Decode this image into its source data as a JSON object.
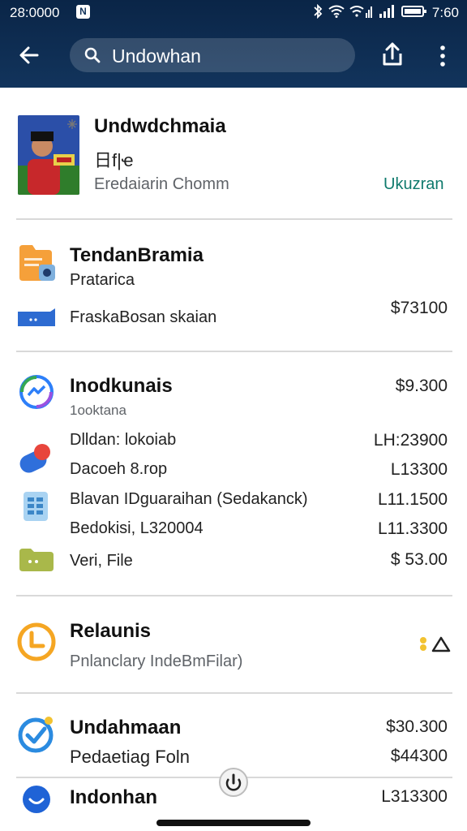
{
  "status_bar": {
    "time": "28:0000",
    "notification_glyph": "N",
    "clock": "7:60"
  },
  "search": {
    "query": "Undowhan"
  },
  "profile": {
    "name": "Undwdchmaia",
    "subtitle": "日f|ҽ",
    "detail": "Eredaiarin Chomm",
    "action": "Ukuzran"
  },
  "section_one": {
    "title": "TendanBramia",
    "subtitle": "Pratarica",
    "row_label": "FraskaBosan skaian",
    "row_amount": "$73100"
  },
  "section_two": {
    "title": "Inodkunais",
    "title_amount": "$9.300",
    "subtitle": "1ooktana",
    "rows": [
      {
        "label": "Dlldan: lokoiab",
        "amount": "LH:23900"
      },
      {
        "label": "Dacoeh 8.rop",
        "amount": "L13300"
      },
      {
        "label": "Blavan IDguaraihan (Sedakanck)",
        "amount": "L11.1500"
      },
      {
        "label": "Bedokisi, L320004",
        "amount": "L11.3300"
      },
      {
        "label": "Veri, File",
        "amount": "$ 53.00"
      }
    ]
  },
  "section_three": {
    "title": "Relaunis",
    "subtitle": "Pnlanclary IndeBmFilar)"
  },
  "section_four": {
    "title": "Undahmaan",
    "title_amount": "$30.300",
    "row_label": "Pedaetiag Foln",
    "row_amount": "$44300"
  },
  "section_five": {
    "title": "Indonhan",
    "title_amount": "L313300"
  },
  "colors": {
    "appbar": "#0a2547",
    "accent_teal": "#0f7a6d",
    "folder_orange": "#f5a03a",
    "messenger_blue": "#2d7ff9",
    "clock_orange": "#f5a623"
  },
  "icons": {
    "back": "arrow-left-icon",
    "search": "search-icon",
    "share": "share-icon",
    "more": "more-vert-icon"
  }
}
